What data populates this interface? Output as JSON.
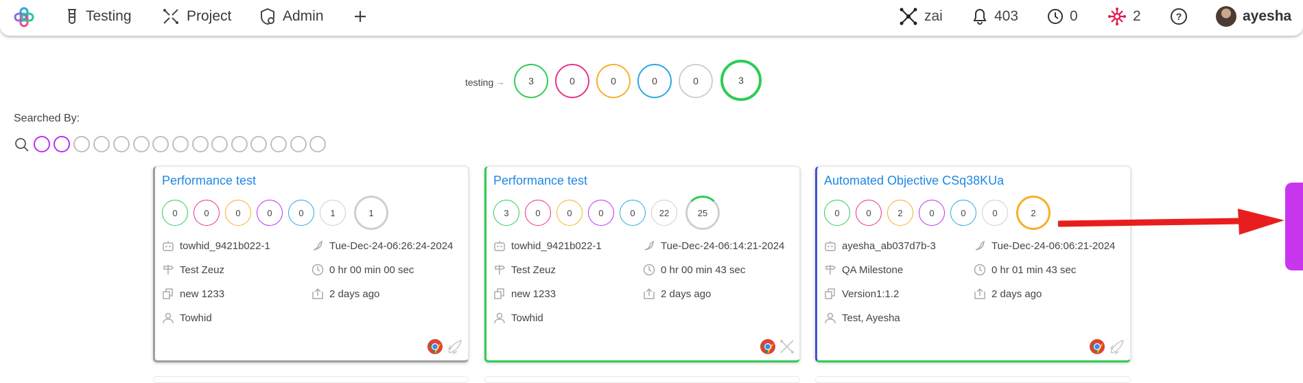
{
  "nav": {
    "items": [
      {
        "label": "Testing",
        "icon": "flask-icon"
      },
      {
        "label": "Project",
        "icon": "project-icon"
      },
      {
        "label": "Admin",
        "icon": "shield-gear-icon"
      }
    ],
    "add_icon": "plus-icon",
    "right": {
      "workspace": "zai",
      "notifications": "403",
      "timers": "0",
      "network": "2",
      "user": "ayesha"
    }
  },
  "summary": {
    "label": "testing",
    "arrow": "→",
    "counts": [
      "3",
      "0",
      "0",
      "0",
      "0"
    ],
    "total": "3"
  },
  "filters": {
    "label": "Searched By:"
  },
  "cards": [
    {
      "title": "Performance test",
      "counts": [
        "0",
        "0",
        "0",
        "0",
        "0",
        "1"
      ],
      "total": "1",
      "owner": "towhid_9421b022-1",
      "date": "Tue-Dec-24-06:26:24-2024",
      "milestone": "Test Zeuz",
      "duration": "0 hr 00 min 00 sec",
      "version": "new 1233",
      "ago": "2 days ago",
      "assignee": "Towhid",
      "accent": "#9e9e9e"
    },
    {
      "title": "Performance test",
      "counts": [
        "3",
        "0",
        "0",
        "0",
        "0",
        "22"
      ],
      "total": "25",
      "owner": "towhid_9421b022-1",
      "date": "Tue-Dec-24-06:14:21-2024",
      "milestone": "Test Zeuz",
      "duration": "0 hr 00 min 43 sec",
      "version": "new 1233",
      "ago": "2 days ago",
      "assignee": "Towhid",
      "accent": "#2ecc55"
    },
    {
      "title": "Automated Objective CSq38KUa",
      "counts": [
        "0",
        "0",
        "2",
        "0",
        "0",
        "0"
      ],
      "total": "2",
      "owner": "ayesha_ab037d7b-3",
      "date": "Tue-Dec-24-06:06:21-2024",
      "milestone": "QA Milestone",
      "duration": "0 hr 01 min 43 sec",
      "version": "Version1:1.2",
      "ago": "2 days ago",
      "assignee": "Test, Ayesha",
      "accent": "#3f51d8"
    }
  ],
  "colors": {
    "passed": "#2ecc55",
    "failed": "#ec2f8c",
    "blocked": "#f6b02a",
    "purple": "#c02cf3",
    "skipped": "#29a8e0",
    "neutral": "#cfcfcf",
    "link": "#1e88e5",
    "arrow": "#e81e1e"
  }
}
